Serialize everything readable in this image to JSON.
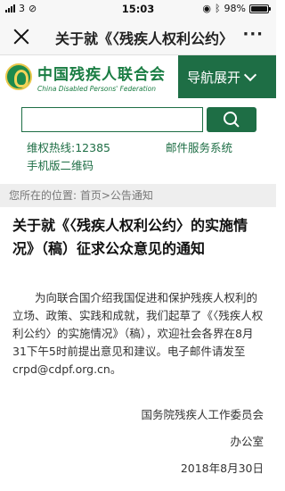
{
  "status_bar": {
    "carrier_signal": "3",
    "time": "15:03",
    "battery": "98%",
    "battery_level": 0.98
  },
  "nav_bar": {
    "title": "关于就《〈残疾人权利公约〉的实施情况》（稿）征求公众意见的通知",
    "close_icon": "close-icon",
    "more_label": "···"
  },
  "site_header": {
    "logo_cn": "中国残疾人联合会",
    "logo_en": "China Disabled Persons' Federation",
    "nav_expand_label": "导航展开",
    "brand_color": "#1e6e45"
  },
  "search": {
    "value": "",
    "placeholder": ""
  },
  "links": {
    "hotline": "维权热线:12385",
    "mail": "邮件服务系统",
    "qr": "手机版二维码"
  },
  "breadcrumb": {
    "text": "您所在的位置:  首页>公告通知"
  },
  "article": {
    "title": "关于就《〈残疾人权利公约〉的实施情况》（稿）征求公众意见的通知",
    "body": "为向联合国介绍我国促进和保护残疾人权利的立场、政策、实践和成就，我们起草了《〈残疾人权利公约〉的实施情况》（稿），欢迎社会各界在8月31下午5时前提出意见和建议。电子邮件请发至crpd@cdpf.org.cn。",
    "sign_org": "国务院残疾人工作委员会",
    "sign_office": "办公室",
    "sign_date": "2018年8月30日"
  }
}
